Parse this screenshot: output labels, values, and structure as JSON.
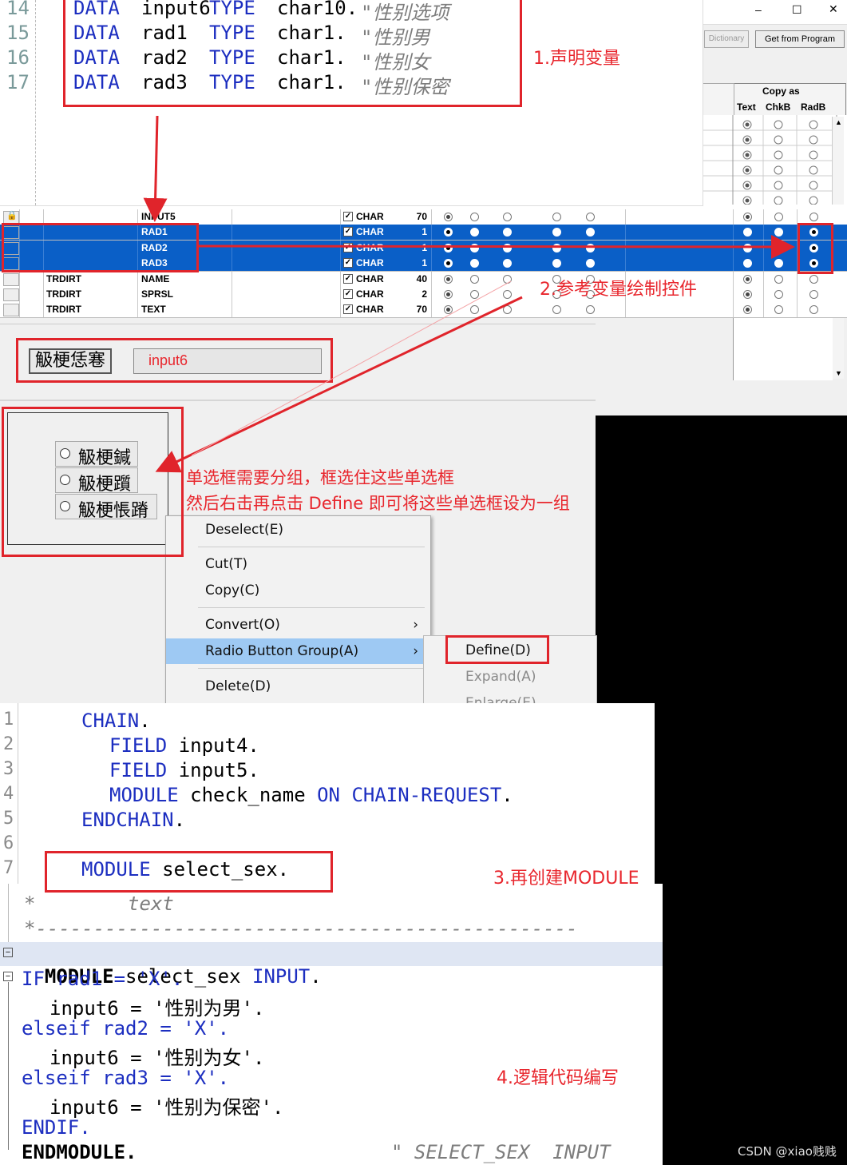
{
  "code_top": {
    "lines": [
      {
        "num": "14",
        "kw": "DATA",
        "name": "input6",
        "type": "TYPE",
        "tp": "char10.",
        "comment": "\"性别选项"
      },
      {
        "num": "15",
        "kw": "DATA",
        "name": "rad1",
        "type": "TYPE",
        "tp": "char1.",
        "comment": "\"性别男"
      },
      {
        "num": "16",
        "kw": "DATA",
        "name": "rad2",
        "type": "TYPE",
        "tp": "char1.",
        "comment": "\"性别女"
      },
      {
        "num": "17",
        "kw": "DATA",
        "name": "rad3",
        "type": "TYPE",
        "tp": "char1.",
        "comment": "\"性别保密"
      }
    ]
  },
  "annotations": {
    "a1": "1.声明变量",
    "a2": "2.参考变量绘制控件",
    "a3_line1": "单选框需要分组，框选住这些单选框",
    "a3_line2": "然后右击再点击 Define 即可将这些单选框设为一组",
    "a4": "3.再创建MODULE",
    "a5": "4.逻辑代码编写"
  },
  "sap_window": {
    "minimize": "–",
    "maximize": "☐",
    "close": "✕",
    "dict_button": "Dictionary",
    "get_button": "Get from Program",
    "copy_as": "Copy as",
    "col_text": "Text",
    "col_chkb": "ChkB",
    "col_radb": "RadB"
  },
  "grid_rows": [
    {
      "table": "",
      "field": "INPUT5",
      "type": "CHAR",
      "len": "70",
      "sel": false,
      "lock": true
    },
    {
      "table": "",
      "field": "RAD1",
      "type": "CHAR",
      "len": "1",
      "sel": true,
      "lock": false
    },
    {
      "table": "",
      "field": "RAD2",
      "type": "CHAR",
      "len": "1",
      "sel": true,
      "lock": false
    },
    {
      "table": "",
      "field": "RAD3",
      "type": "CHAR",
      "len": "1",
      "sel": true,
      "lock": false
    },
    {
      "table": "TRDIRT",
      "field": "NAME",
      "type": "CHAR",
      "len": "40",
      "sel": false,
      "lock": false
    },
    {
      "table": "TRDIRT",
      "field": "SPRSL",
      "type": "CHAR",
      "len": "2",
      "sel": false,
      "lock": false
    },
    {
      "table": "TRDIRT",
      "field": "TEXT",
      "type": "CHAR",
      "len": "70",
      "sel": false,
      "lock": false
    }
  ],
  "screen_painter": {
    "label_garbled": "觙梗恁寋",
    "input_text": "input6",
    "radio1": "觙梗鍼",
    "radio2": "觙梗躓",
    "radio3": "觙梗悵蹐"
  },
  "context_menu": {
    "items": [
      "Deselect(E)",
      "Cut(T)",
      "Copy(C)",
      "Convert(O)",
      "Radio Button Group(A)",
      "Delete(D)"
    ],
    "submenu": [
      "Define(D)",
      "Expand(A)",
      "Enlarge(E)"
    ]
  },
  "code_mid": {
    "lines": [
      {
        "num": "1",
        "text": "CHAIN."
      },
      {
        "num": "2",
        "text": "FIELD input4."
      },
      {
        "num": "3",
        "text": "FIELD input5."
      },
      {
        "num": "4",
        "text": "MODULE check_name ON CHAIN-REQUEST."
      },
      {
        "num": "5",
        "text": "ENDCHAIN."
      },
      {
        "num": "6",
        "text": ""
      },
      {
        "num": "7",
        "text": "MODULE select_sex."
      }
    ]
  },
  "code_bottom": {
    "comment1": "*        text",
    "comment2": "*-----------------------------------------------",
    "module_line": "MODULE select_sex INPUT.",
    "if_line": "IF rad1 = 'X'.",
    "assign1": "input6 = '性别为男'.",
    "elseif1": "elseif rad2 = 'X'.",
    "assign2": "input6 = '性别为女'.",
    "elseif2": "elseif rad3 = 'X'.",
    "assign3": "input6 = '性别为保密'.",
    "endif": "ENDIF.",
    "endmodule": "ENDMODULE.",
    "end_comment": "\" SELECT_SEX  INPUT"
  },
  "watermark": "CSDN @xiao贱贱"
}
